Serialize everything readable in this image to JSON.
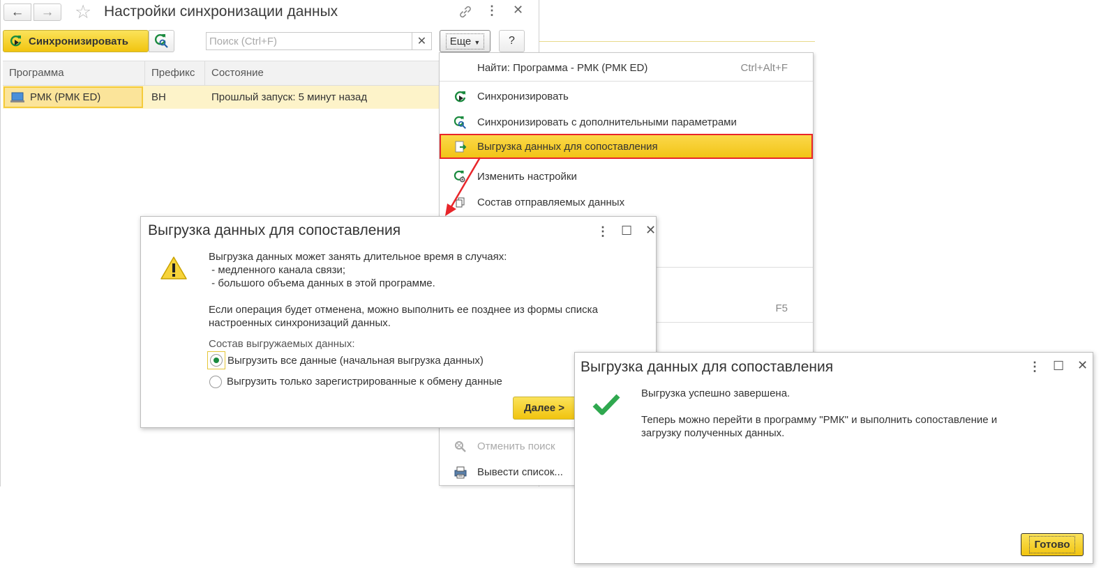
{
  "window": {
    "title": "Настройки синхронизации данных"
  },
  "toolbar": {
    "sync_label": "Синхронизировать",
    "search_placeholder": "Поиск (Ctrl+F)",
    "search_value": "",
    "more_label": "Еще",
    "help_label": "?"
  },
  "table": {
    "columns": [
      "Программа",
      "Префикс",
      "Состояние"
    ],
    "rows": [
      {
        "program": "РМК (РМК ED)",
        "prefix": "ВН",
        "state": "Прошлый запуск: 5 минут назад"
      }
    ]
  },
  "menu": {
    "items": [
      {
        "label": "Найти: Программа - РМК (РМК ED)",
        "shortcut": "Ctrl+Alt+F"
      },
      {
        "label": "Синхронизировать"
      },
      {
        "label": "Синхронизировать с дополнительными параметрами"
      },
      {
        "label": "Выгрузка данных для сопоставления"
      },
      {
        "label": "Изменить настройки"
      },
      {
        "label": "Состав отправляемых данных"
      },
      {
        "label": "",
        "shortcut": "F5"
      },
      {
        "label": "Отменить поиск"
      },
      {
        "label": "Вывести список..."
      }
    ]
  },
  "dialog_export": {
    "title": "Выгрузка данных для сопоставления",
    "lines": [
      "Выгрузка данных может занять длительное время в случаях:",
      " - медленного канала связи;",
      " - большого объема данных в этой программе.",
      "Если операция будет отменена, можно выполнить ее позднее из формы списка",
      "настроенных синхронизаций данных."
    ],
    "compose_label": "Состав выгружаемых данных:",
    "radio_all": "Выгрузить все данные (начальная выгрузка данных)",
    "radio_registered": "Выгрузить только зарегистрированные к обмену данные",
    "selected": "all",
    "next_label": "Далее >"
  },
  "dialog_done": {
    "title": "Выгрузка данных для сопоставления",
    "line1": "Выгрузка успешно завершена.",
    "line2": "Теперь можно перейти в программу \"РМК\" и выполнить сопоставление и",
    "line3": "загрузку полученных данных.",
    "done_label": "Готово"
  },
  "colors": {
    "accent_yellow": "#f1c40f",
    "highlight_border": "#e8252a",
    "sync_green": "#1a8a3e",
    "row_highlight": "#fdf3c9"
  }
}
